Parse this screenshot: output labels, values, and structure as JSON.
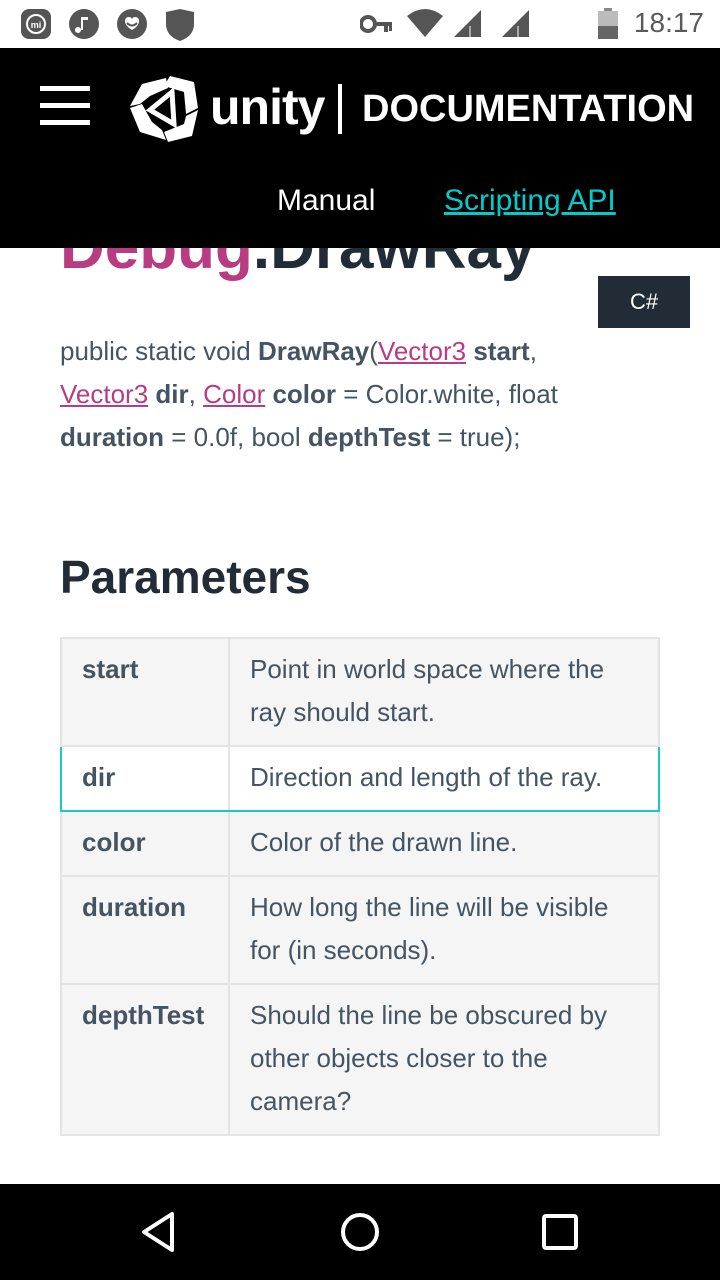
{
  "status_bar": {
    "time": "18:17",
    "icons": [
      "mi-icon",
      "music-icon",
      "heart-badge-icon",
      "shield-icon",
      "key-icon",
      "wifi-icon",
      "signal-icon",
      "signal-icon",
      "battery-icon"
    ]
  },
  "header": {
    "logo_word": "unity",
    "logo_section": "DOCUMENTATION",
    "nav": {
      "manual": "Manual",
      "scripting_api": "Scripting API"
    }
  },
  "page": {
    "title_class": "Debug",
    "title_sep": ".",
    "title_method": "DrawRay",
    "lang_button": "C#"
  },
  "signature": {
    "p1": "public static void ",
    "method": "DrawRay",
    "p2": "(",
    "type1": "Vector3",
    "arg1": "start",
    "p3": ", ",
    "type2": "Vector3",
    "arg2": "dir",
    "p4": ", ",
    "type3": "Color",
    "arg3": "color",
    "p5": " = Color.white, float ",
    "arg4": "duration",
    "p6": " = 0.0f, bool ",
    "arg5": "depthTest",
    "p7": " = true);"
  },
  "parameters": {
    "heading": "Parameters",
    "rows": [
      {
        "name": "start",
        "description": "Point in world space where the ray should start."
      },
      {
        "name": "dir",
        "description": "Direction and length of the ray."
      },
      {
        "name": "color",
        "description": "Color of the drawn line."
      },
      {
        "name": "duration",
        "description": "How long the line will be visible for (in seconds)."
      },
      {
        "name": "depthTest",
        "description": "Should the line be obscured by other objects closer to the camera?"
      }
    ]
  },
  "nav_bar": {
    "buttons": [
      "back-icon",
      "home-icon",
      "recents-icon"
    ]
  },
  "colors": {
    "accent_link": "#b83c82",
    "nav_active": "#00cccc",
    "highlight_border": "#19c8c8",
    "header_bg": "#000000"
  }
}
